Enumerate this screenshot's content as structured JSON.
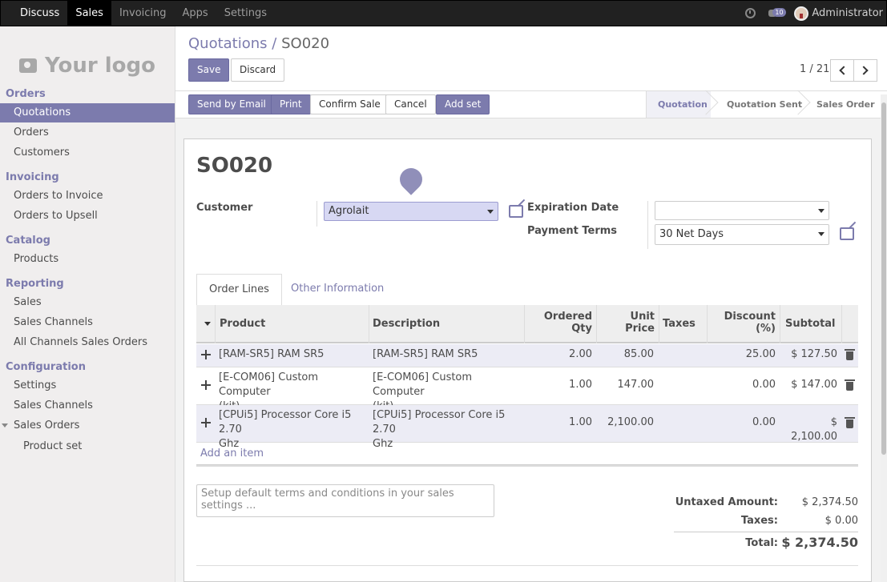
{
  "topbar": {
    "menu": [
      "Discuss",
      "Sales",
      "Invoicing",
      "Apps",
      "Settings"
    ],
    "message_count": "10",
    "user": "Administrator"
  },
  "sidebar": {
    "logo_text": "Your logo",
    "sections": {
      "orders": "Orders",
      "invoicing": "Invoicing",
      "catalog": "Catalog",
      "reporting": "Reporting",
      "configuration": "Configuration"
    },
    "items": {
      "quotations": "Quotations",
      "orders": "Orders",
      "customers": "Customers",
      "orders_to_invoice": "Orders to Invoice",
      "orders_to_upsell": "Orders to Upsell",
      "products": "Products",
      "sales": "Sales",
      "sales_channels": "Sales Channels",
      "all_channels_sales_orders": "All Channels Sales Orders",
      "settings": "Settings",
      "config_sales_channels": "Sales Channels",
      "sales_orders": "Sales Orders",
      "product_set": "Product set"
    }
  },
  "breadcrumb": {
    "parent": "Quotations",
    "separator": "/",
    "current": "SO020"
  },
  "control": {
    "save": "Save",
    "discard": "Discard",
    "pager": "1 / 21"
  },
  "actions": {
    "send_by_email": "Send by Email",
    "print": "Print",
    "confirm_sale": "Confirm Sale",
    "cancel": "Cancel",
    "add_set": "Add set"
  },
  "statusbar": {
    "stages": [
      "Quotation",
      "Quotation Sent",
      "Sales Order"
    ],
    "active": "Quotation"
  },
  "form": {
    "title": "SO020",
    "customer_label": "Customer",
    "customer_value": "Agrolait",
    "expiration_label": "Expiration Date",
    "expiration_value": "",
    "payment_terms_label": "Payment Terms",
    "payment_terms_value": "30 Net Days"
  },
  "tabs": [
    "Order Lines",
    "Other Information"
  ],
  "table": {
    "headers": {
      "product": "Product",
      "description": "Description",
      "ordered_qty_1": "Ordered",
      "ordered_qty_2": "Qty",
      "unit_price_1": "Unit",
      "unit_price_2": "Price",
      "taxes": "Taxes",
      "discount_1": "Discount",
      "discount_2": "(%)",
      "subtotal": "Subtotal"
    },
    "rows": [
      {
        "product_1": "[RAM-SR5] RAM SR5",
        "product_2": "",
        "description_1": "[RAM-SR5] RAM SR5",
        "description_2": "",
        "qty": "2.00",
        "price": "85.00",
        "taxes": "",
        "discount": "25.00",
        "subtotal": "$ 127.50"
      },
      {
        "product_1": "[E-COM06] Custom Computer",
        "product_2": "(kit)",
        "description_1": "[E-COM06] Custom Computer",
        "description_2": "(kit)",
        "qty": "1.00",
        "price": "147.00",
        "taxes": "",
        "discount": "0.00",
        "subtotal": "$ 147.00"
      },
      {
        "product_1": "[CPUi5] Processor Core i5 2.70",
        "product_2": "Ghz",
        "description_1": "[CPUi5] Processor Core i5 2.70",
        "description_2": "Ghz",
        "qty": "1.00",
        "price": "2,100.00",
        "taxes": "",
        "discount": "0.00",
        "subtotal": "$ 2,100.00"
      }
    ],
    "add_item": "Add an item"
  },
  "terms_placeholder": "Setup default terms and conditions in your sales settings ...",
  "totals": {
    "untaxed_label": "Untaxed Amount:",
    "untaxed_value": "$ 2,374.50",
    "taxes_label": "Taxes:",
    "taxes_value": "$ 0.00",
    "total_label": "Total:",
    "total_value": "$ 2,374.50"
  },
  "colors": {
    "accent": "#7c7bad",
    "topbar": "#212121"
  }
}
